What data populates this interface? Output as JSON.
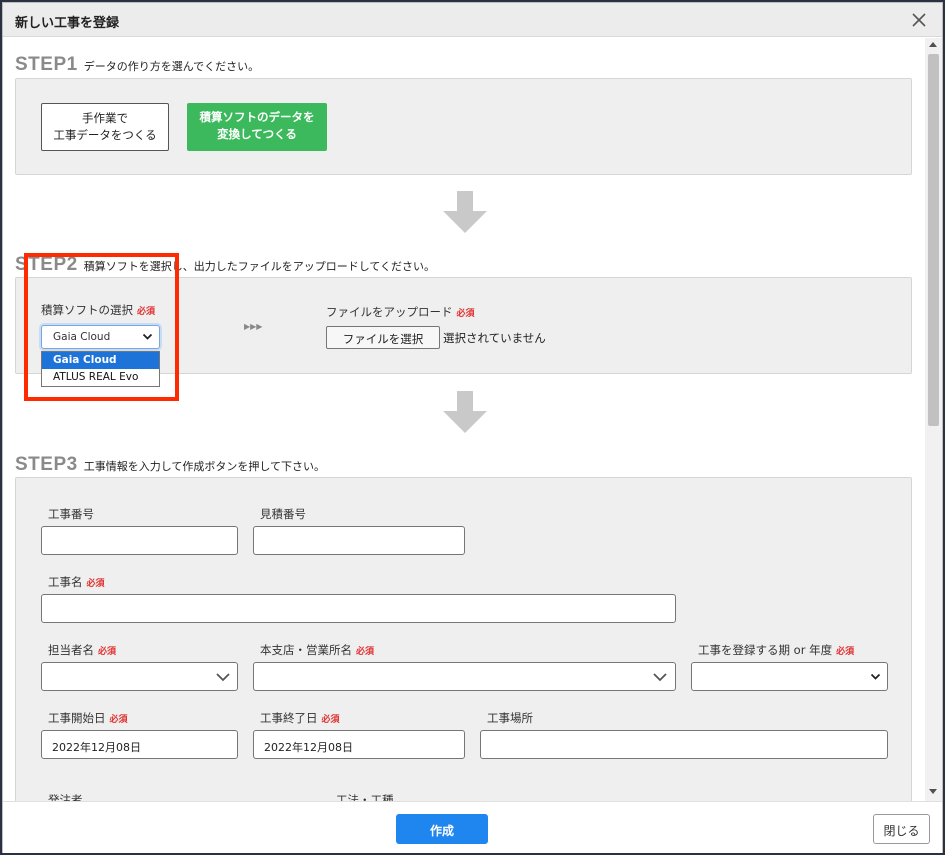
{
  "dialog": {
    "title": "新しい工事を登録",
    "close_icon": "close-icon"
  },
  "step1": {
    "label": "STEP1",
    "description": "データの作り方を選んでください。",
    "manual_button": {
      "line1": "手作業で",
      "line2": "工事データをつくる"
    },
    "convert_button": {
      "line1": "積算ソフトのデータを",
      "line2": "変換してつくる"
    },
    "accent": "#3cb95c"
  },
  "step2": {
    "label": "STEP2",
    "description": "積算ソフトを選択し、出力したファイルをアップロードしてください。",
    "software_label": "積算ソフトの選択",
    "required": "必須",
    "software_selected": "Gaia Cloud",
    "software_options": [
      "Gaia Cloud",
      "ATLUS REAL Evo"
    ],
    "upload_label": "ファイルをアップロード",
    "file_button": "ファイルを選択",
    "file_status": "選択されていません",
    "highlight_color": "#ff2a00"
  },
  "step3": {
    "label": "STEP3",
    "description": "工事情報を入力して作成ボタンを押して下さい。",
    "fields": {
      "project_number": "工事番号",
      "estimate_number": "見積番号",
      "project_name": "工事名",
      "person_in_charge": "担当者名",
      "branch": "本支店・営業所名",
      "fiscal_period": "工事を登録する期 or 年度",
      "start_date": "工事開始日",
      "start_date_value": "2022年12月08日",
      "end_date": "工事終了日",
      "end_date_value": "2022年12月08日",
      "location": "工事場所",
      "client": "発注者",
      "method": "工法・工種"
    },
    "required": "必須"
  },
  "footer": {
    "create_button": "作成",
    "close_button": "閉じる",
    "create_color": "#1f86f0"
  }
}
